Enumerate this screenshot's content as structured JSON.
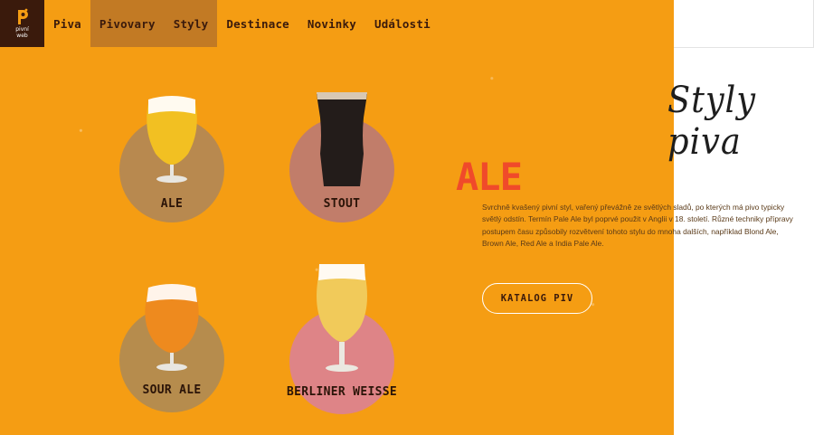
{
  "logo": {
    "line1": "pivní",
    "line2": "web"
  },
  "nav": {
    "items": [
      {
        "label": "Piva",
        "active": false
      },
      {
        "label": "Pivovary",
        "active": true
      },
      {
        "label": "Styly",
        "active": true
      },
      {
        "label": "Destinace",
        "active": false
      },
      {
        "label": "Novinky",
        "active": false
      },
      {
        "label": "Události",
        "active": false
      }
    ]
  },
  "beers": [
    {
      "label": "ALE",
      "circle_color": "#b8894f",
      "beer_color": "#f2c022"
    },
    {
      "label": "STOUT",
      "circle_color": "#c17d6a",
      "beer_color": "#231c1a"
    },
    {
      "label": "SOUR ALE",
      "circle_color": "#b68c4d",
      "beer_color": "#ee8a1e"
    },
    {
      "label": "BERLINER WEISSE",
      "circle_color": "#de8487",
      "beer_color": "#f1ca5a"
    }
  ],
  "page_title": "Styly piva",
  "selected_style": {
    "name": "ALE",
    "description": "Svrchně kvašený pivní styl, vařený převážně ze světlých sladů, po kterých má pivo typicky světlý odstín. Termín Pale Ale byl poprvé použit v Anglii v 18. století. Různé techniky přípravy postupem času způsobily rozvětvení tohoto stylu do mnoha dalších, například Blond Ale, Brown Ale, Red Ale a India Pale Ale."
  },
  "catalog_button": "KATALOG PIV",
  "colors": {
    "background": "#f59d13",
    "nav_active": "#c27a24",
    "heading": "#f04a2a",
    "logo_bg": "#3a1a0c"
  }
}
